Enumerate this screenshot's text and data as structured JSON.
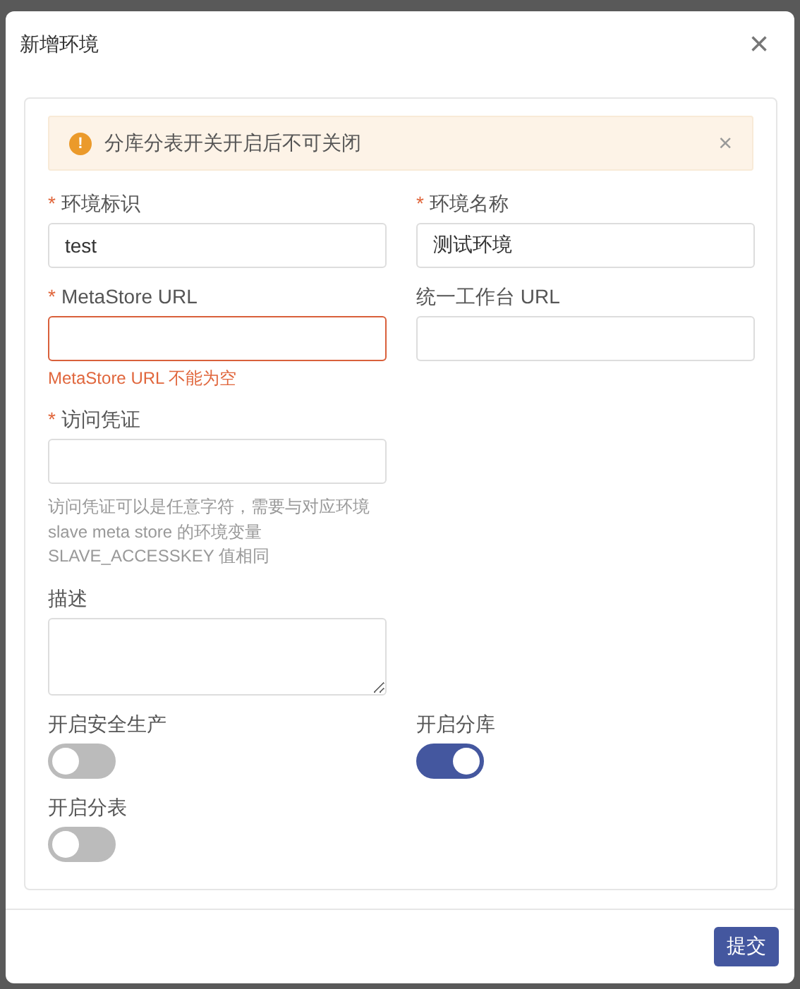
{
  "dialog": {
    "title": "新增环境",
    "close_icon": "×"
  },
  "alert": {
    "message": "分库分表开关开启后不可关闭",
    "icon": "!",
    "close": "×"
  },
  "rows": [
    {
      "fields": [
        {
          "kind": "input",
          "label": "环境标识",
          "required_mark": "*",
          "value": "test"
        },
        {
          "kind": "input",
          "label": "环境名称",
          "required_mark": "*",
          "value": "测试环境"
        }
      ]
    },
    {
      "fields": [
        {
          "kind": "input",
          "label": "MetaStore URL",
          "required_mark": "*",
          "error": "MetaStore URL 不能为空"
        },
        {
          "kind": "input",
          "label": "统一工作台 URL"
        }
      ]
    },
    {
      "fields": [
        {
          "kind": "input",
          "label": "访问凭证",
          "required_mark": "*",
          "help": "访问凭证可以是任意字符，需要与对应环境 slave meta store 的环境变量 SLAVE_ACCESSKEY 值相同"
        }
      ]
    },
    {
      "fields": [
        {
          "kind": "textarea",
          "label": "描述"
        }
      ]
    },
    {
      "fields": [
        {
          "kind": "switch",
          "label": "开启安全生产",
          "on": false
        },
        {
          "kind": "switch",
          "label": "开启分库",
          "on": true
        }
      ]
    },
    {
      "fields": [
        {
          "kind": "switch",
          "label": "开启分表",
          "on": false
        }
      ]
    }
  ],
  "footer": {
    "submit": "提交"
  }
}
